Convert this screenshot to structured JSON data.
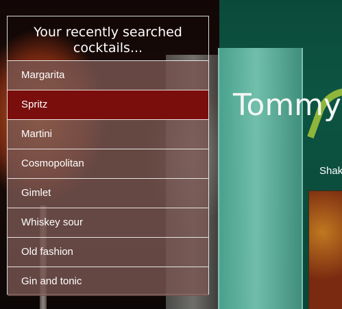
{
  "recent_panel": {
    "title": "Your recently searched cocktails...",
    "items": [
      {
        "label": "Margarita",
        "active": false
      },
      {
        "label": "Spritz",
        "active": true
      },
      {
        "label": "Martini",
        "active": false
      },
      {
        "label": "Cosmopolitan",
        "active": false
      },
      {
        "label": "Gimlet",
        "active": false
      },
      {
        "label": "Whiskey sour",
        "active": false
      },
      {
        "label": "Old fashion",
        "active": false
      },
      {
        "label": "Gin and tonic",
        "active": false
      }
    ]
  },
  "background_promo": {
    "title": "Tommy",
    "subtitle": "Shak"
  },
  "colors": {
    "active_item": "#7a0e0c",
    "item_background": "#785550",
    "promo_green": "#0d5442"
  }
}
